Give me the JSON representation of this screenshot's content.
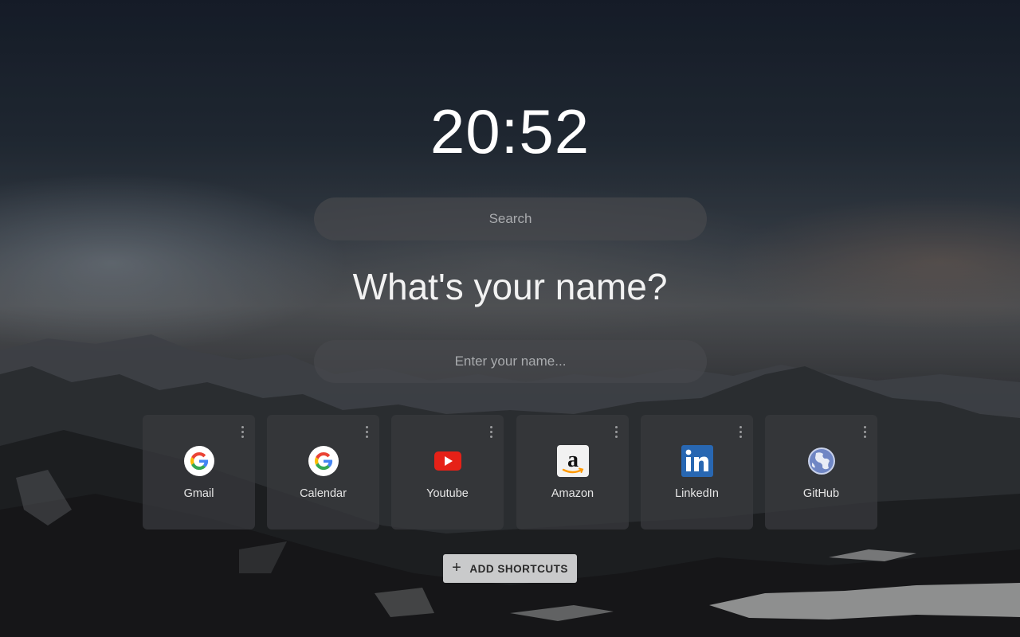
{
  "clock": {
    "time": "20:52"
  },
  "search": {
    "placeholder": "Search",
    "value": ""
  },
  "greeting": {
    "question": "What's your name?"
  },
  "name_field": {
    "placeholder": "Enter your name...",
    "value": ""
  },
  "shortcuts": [
    {
      "label": "Gmail",
      "icon": "google-icon"
    },
    {
      "label": "Calendar",
      "icon": "google-icon"
    },
    {
      "label": "Youtube",
      "icon": "youtube-icon"
    },
    {
      "label": "Amazon",
      "icon": "amazon-icon"
    },
    {
      "label": "LinkedIn",
      "icon": "linkedin-icon"
    },
    {
      "label": "GitHub",
      "icon": "globe-icon"
    }
  ],
  "add_shortcuts": {
    "label": "ADD SHORTCUTS",
    "icon": "plus-icon"
  },
  "colors": {
    "tile_bg": "#37383c",
    "button_bg": "#c9cacb",
    "youtube_red": "#e62117",
    "linkedin_blue": "#2867b2"
  }
}
